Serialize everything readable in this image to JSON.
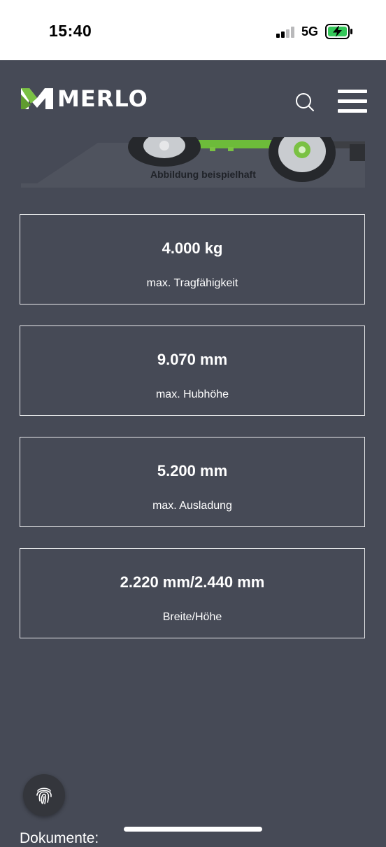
{
  "status_bar": {
    "time": "15:40",
    "network": "5G",
    "signal_icon": "signal-bars-icon",
    "battery_icon": "battery-charging-icon",
    "battery_color": "#34c759"
  },
  "header": {
    "brand": "MERLO",
    "logo_color": "#7ac143",
    "search_icon": "search-icon",
    "menu_icon": "hamburger-menu-icon"
  },
  "hero": {
    "caption": "Abbildung beispielhaft"
  },
  "specs": [
    {
      "value": "4.000 kg",
      "label": "max. Tragfähigkeit"
    },
    {
      "value": "9.070 mm",
      "label": "max. Hubhöhe"
    },
    {
      "value": "5.200 mm",
      "label": "max. Ausladung"
    },
    {
      "value": "2.220 mm/2.440 mm",
      "label": "Breite/Höhe"
    }
  ],
  "footer": {
    "section_title": "Dokumente:",
    "fingerprint_icon": "fingerprint-icon"
  },
  "colors": {
    "background": "#464a56",
    "accent_green": "#7ac143"
  }
}
